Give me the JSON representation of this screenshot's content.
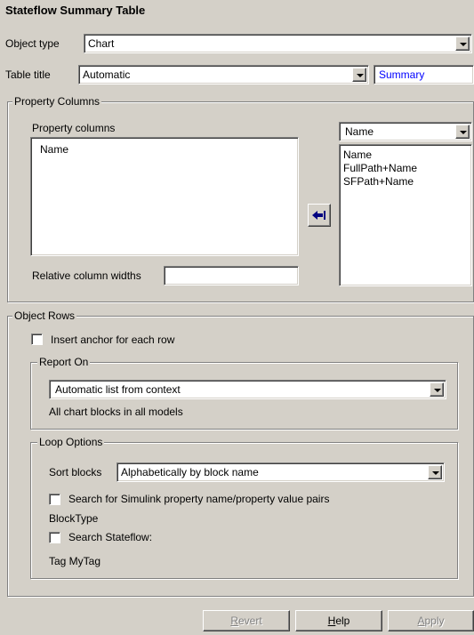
{
  "title": "Stateflow Summary Table",
  "object_type": {
    "label": "Object type",
    "value": "Chart"
  },
  "table_title": {
    "label": "Table title",
    "value": "Automatic",
    "summary": "Summary"
  },
  "property_columns": {
    "group_label": "Property Columns",
    "list_label": "Property columns",
    "items": [
      "Name"
    ],
    "relative_widths_label": "Relative column widths",
    "relative_widths_value": "",
    "filter_value": "Name",
    "available": [
      "Name",
      "FullPath+Name",
      "SFPath+Name"
    ],
    "add_button_icon": "arrow-left-to-bar-icon"
  },
  "object_rows": {
    "group_label": "Object Rows",
    "insert_anchor_label": "Insert anchor for each row",
    "insert_anchor_checked": false,
    "report_on": {
      "group_label": "Report On",
      "value": "Automatic list from context",
      "description": "All chart blocks in all models"
    },
    "loop_options": {
      "group_label": "Loop Options",
      "sort_label": "Sort blocks",
      "sort_value": "Alphabetically by block name",
      "search_simulink_label": "Search for Simulink property name/property value pairs",
      "search_simulink_checked": false,
      "block_type_text": "BlockType",
      "search_stateflow_label": "Search Stateflow:",
      "search_stateflow_checked": false,
      "tag_text": "Tag MyTag"
    }
  },
  "buttons": {
    "revert_first": "R",
    "revert_rest": "evert",
    "help_first": "H",
    "help_rest": "elp",
    "apply_first": "A",
    "apply_rest": "pply"
  },
  "colors": {
    "summary_text": "#0000ff",
    "face": "#d4d0c8"
  }
}
